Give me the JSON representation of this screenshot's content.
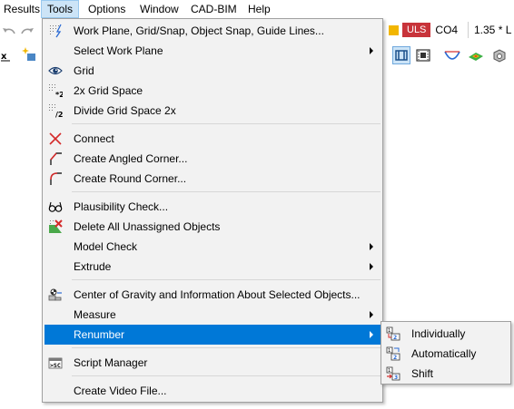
{
  "menubar": {
    "items": [
      {
        "label": "Results"
      },
      {
        "label": "Tools"
      },
      {
        "label": "Options"
      },
      {
        "label": "Window"
      },
      {
        "label": "CAD-BIM"
      },
      {
        "label": "Help"
      }
    ]
  },
  "status": {
    "design_situation": "ULS",
    "combination": "CO4",
    "load_factor": "1.35 * L"
  },
  "tools_menu": {
    "items": [
      {
        "label": "Work Plane, Grid/Snap, Object Snap, Guide Lines...",
        "icon": "work-plane-icon"
      },
      {
        "label": "Select Work Plane",
        "icon": "",
        "submenu": true
      },
      {
        "label": "Grid",
        "icon": "grid-eye-icon"
      },
      {
        "label": "2x Grid Space",
        "icon": "grid-double-icon"
      },
      {
        "label": "Divide Grid Space 2x",
        "icon": "grid-half-icon"
      },
      {
        "label": "Connect",
        "icon": "connect-cross-icon"
      },
      {
        "label": "Create Angled Corner...",
        "icon": "angled-corner-icon"
      },
      {
        "label": "Create Round Corner...",
        "icon": "round-corner-icon"
      },
      {
        "label": "Plausibility Check...",
        "icon": "glasses-icon"
      },
      {
        "label": "Delete All Unassigned Objects",
        "icon": "delete-unassigned-icon"
      },
      {
        "label": "Model Check",
        "icon": "",
        "submenu": true
      },
      {
        "label": "Extrude",
        "icon": "",
        "submenu": true
      },
      {
        "label": "Center of Gravity and Information About Selected Objects...",
        "icon": "center-gravity-icon"
      },
      {
        "label": "Measure",
        "icon": "",
        "submenu": true
      },
      {
        "label": "Renumber",
        "icon": "",
        "submenu": true
      },
      {
        "label": "Script Manager",
        "icon": "script-manager-icon"
      },
      {
        "label": "Create Video File...",
        "icon": ""
      }
    ]
  },
  "renumber_submenu": {
    "items": [
      {
        "label": "Individually",
        "icon": "renumber-individually-icon"
      },
      {
        "label": "Automatically",
        "icon": "renumber-automatically-icon"
      },
      {
        "label": "Shift",
        "icon": "renumber-shift-icon"
      }
    ]
  },
  "colors": {
    "menu_highlight": "#0078d7",
    "menubar_active": "#cce4f7",
    "uls_badge": "#c8333a",
    "uls_square": "#f2b600",
    "connect_red": "#d42a2a"
  }
}
